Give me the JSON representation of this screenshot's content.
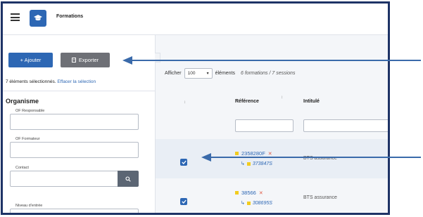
{
  "header": {
    "title": "Formations",
    "menu_icon": "hamburger-icon",
    "logo_icon": "graduation-cap-icon"
  },
  "toolbar": {
    "add_label": "+ Ajouter",
    "export_label": "Exporter",
    "export_icon": "file-icon"
  },
  "selection": {
    "text": "7 éléments sélectionnés.",
    "clear_link": "Effacer la sélection"
  },
  "filters": {
    "section_title": "Organisme",
    "fields": [
      {
        "label": "OF Responsable",
        "value": ""
      },
      {
        "label": "OF Formateur",
        "value": ""
      },
      {
        "label": "Contact",
        "value": ""
      },
      {
        "label": "Niveau d'entrée",
        "value": ""
      }
    ],
    "search_icon": "search-icon"
  },
  "table_controls": {
    "show_label": "Afficher",
    "page_size": "100",
    "elements_label": "éléments",
    "summary": "6 formations / 7 sessions"
  },
  "table": {
    "columns": [
      "Référence",
      "Intitulé"
    ],
    "rows": [
      {
        "checked": true,
        "reference": "2358280F",
        "session": "373847S",
        "intitule": "BTS assurance",
        "highlighted": true
      },
      {
        "checked": true,
        "reference": "38566",
        "session": "308695S",
        "intitule": "BTS assurance",
        "highlighted": false
      }
    ]
  },
  "colors": {
    "primary": "#2d67b4",
    "secondary": "#6e7076",
    "frame": "#1e3366",
    "status_flag": "#f2cc1f",
    "arrow": "#3a6aaa"
  }
}
